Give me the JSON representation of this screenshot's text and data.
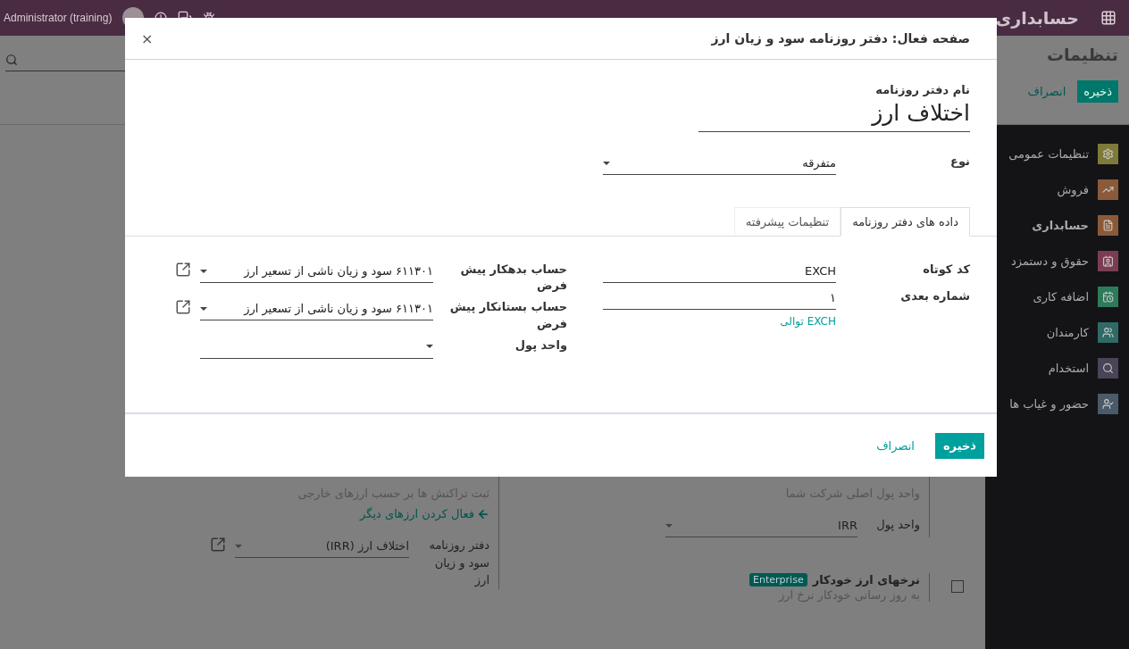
{
  "navbar": {
    "app_title": "حسابداری",
    "user": "Administrator (training)"
  },
  "control_panel": {
    "title": "تنظیمات",
    "buttons": [
      {
        "label": "ذخیره",
        "kind": "primary"
      },
      {
        "label": "انصراف",
        "kind": "link"
      }
    ]
  },
  "sidebar": {
    "items": [
      {
        "label": "تنظیمات عمومی",
        "color": "#7d7a3a",
        "selected": false,
        "kind": "settings"
      },
      {
        "label": "فروش",
        "color": "#8a5a3a",
        "selected": false,
        "kind": "chart"
      },
      {
        "label": "حسابداری",
        "color": "#8a5a38",
        "selected": true,
        "kind": "invoice"
      },
      {
        "label": "حقوق و دستمزد",
        "color": "#7a3e52",
        "selected": false,
        "kind": "payroll"
      },
      {
        "label": "اضافه کاری",
        "color": "#2f7a5a",
        "selected": false,
        "kind": "calendar"
      },
      {
        "label": "کارمندان",
        "color": "#2e6a66",
        "selected": false,
        "kind": "users"
      },
      {
        "label": "استخدام",
        "color": "#4a4458",
        "selected": false,
        "kind": "search"
      },
      {
        "label": "حضور و غیاب ها",
        "color": "#4a5a6a",
        "selected": false,
        "kind": "attendance"
      }
    ]
  },
  "settings": {
    "left": {
      "description": "ثبت تراکنش ها بر حسب ارزهای خارجی",
      "link": "فعال کردن ارزهای دیگر",
      "field_label": "دفتر روزنامه سود و زیان ارز",
      "field_value": "اختلاف ارز (IRR)"
    },
    "right": {
      "description": "واحد پول اصلی شرکت شما",
      "field_label": "واحد پول",
      "field_value": "IRR"
    },
    "auto_rates": {
      "title": "نرخهای ارز خودکار",
      "badge": "Enterprise",
      "description": "به روز رسانی خودکار نرخ ارز",
      "checked": false
    }
  },
  "dialog": {
    "title": "صفحه فعال: دفتر روزنامه سود و زیان ارز",
    "close": "×",
    "name_label": "نام دفتر روزنامه",
    "name_value": "اختلاف ارز",
    "type_label": "نوع",
    "type_value": "متفرقه",
    "tabs": [
      {
        "label": "داده های دفتر روزنامه",
        "selected": true
      },
      {
        "label": "تنظیمات پیشرفته",
        "selected": false
      }
    ],
    "right_fields": [
      {
        "label": "کد کوتاه",
        "value": "EXCH"
      },
      {
        "label": "شماره بعدی",
        "value": "۱"
      }
    ],
    "sequence_link": "EXCH توالی",
    "left_fields": [
      {
        "label": "حساب بدهکار پیش فرض",
        "value": "۶۱۱۳۰۱ سود و زیان ناشی از تسعیر ارز",
        "external": true
      },
      {
        "label": "حساب بستانکار پیش فرض",
        "value": "۶۱۱۳۰۱ سود و زیان ناشی از تسعیر ارز",
        "external": true
      },
      {
        "label": "واحد پول",
        "external": false
      }
    ],
    "buttons": [
      {
        "label": "ذخیره",
        "kind": "primary"
      },
      {
        "label": "انصراف",
        "kind": "link"
      }
    ]
  }
}
